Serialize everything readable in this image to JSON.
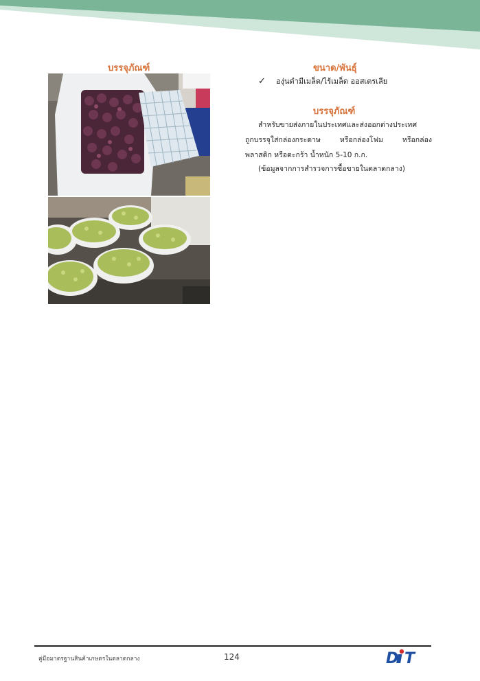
{
  "document": {
    "left_column": {
      "heading": "บรรจุภัณฑ์",
      "photos": [
        {
          "subject": "purple-grapes-in-white-crate"
        },
        {
          "subject": "green-grapes-in-white-bags"
        }
      ]
    },
    "right_column": {
      "size_heading": "ขนาด/พันธุ์",
      "size_items": [
        "องุ่นดำมีเมล็ด/ไร้เมล็ด ออสเตรเลีย"
      ],
      "packaging_heading": "บรรจุภัณฑ์",
      "packaging_lines": [
        "สำหรับขายส่งภายในประเทศและส่งออกต่างประเทศ",
        "ถูกบรรจุใส่กล่องกระดาษ หรือกล่องโฟม หรือกล่อง",
        "พลาสติก หรือตะกร้า น้ำหนัก 5-10 ก.ก.",
        "(ข้อมูลจากการสำรวจการซื้อขายในตลาดกลาง)"
      ]
    }
  },
  "footer": {
    "title": "คู่มือมาตรฐานสินค้าเกษตรในตลาดกลาง",
    "page_number": "124",
    "logo_text": "DIT"
  },
  "colors": {
    "heading": "#d8733a",
    "banner_dark": "#7bb597",
    "banner_light": "#cfe6da",
    "logo_blue": "#1e4fa3",
    "logo_red": "#d32b2b"
  }
}
